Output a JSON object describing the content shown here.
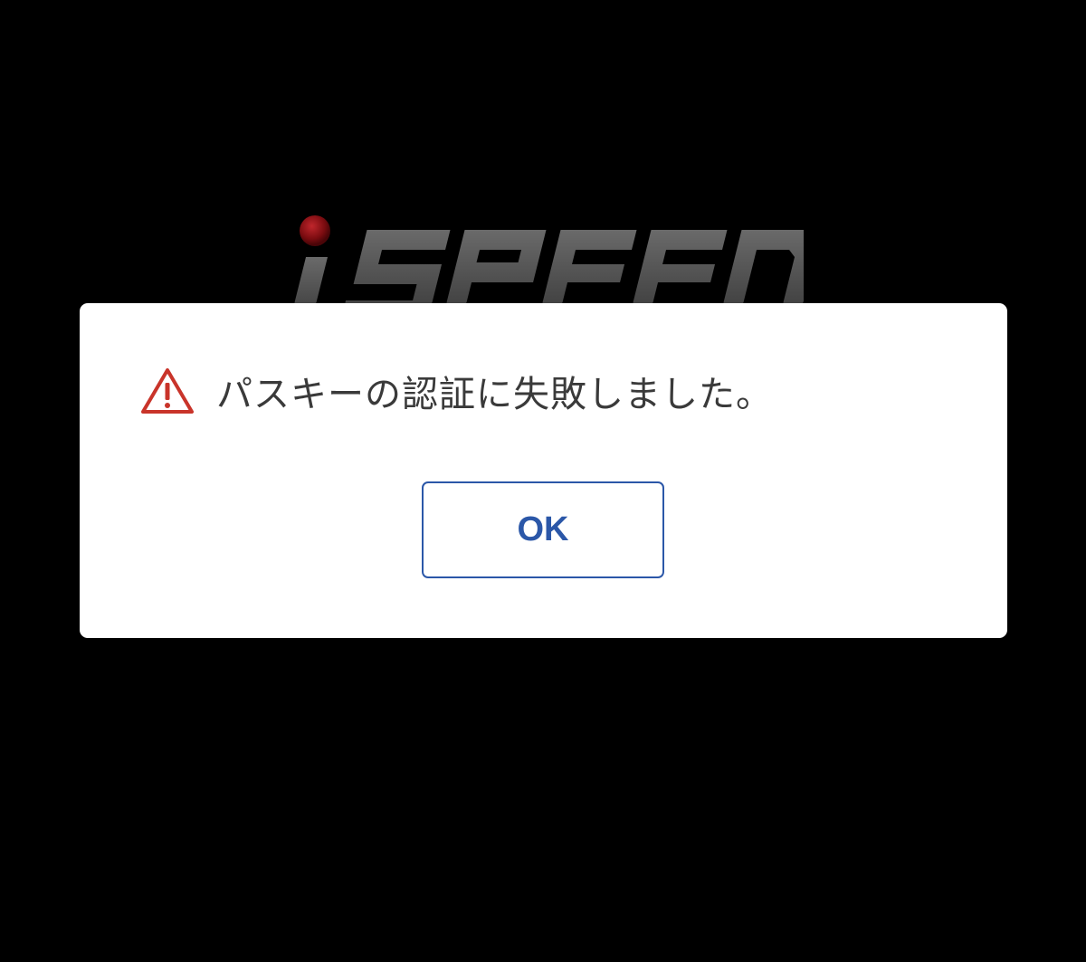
{
  "background": {
    "logo": {
      "text": "iSPEED",
      "name": "ispeed-logo",
      "dot_color": "#8b0f14",
      "letter_color": "#4a4a4a"
    }
  },
  "dialog": {
    "icon": "warning-triangle-icon",
    "icon_color": "#c9342a",
    "message": "パスキーの認証に失敗しました。",
    "ok_label": "OK",
    "accent_color": "#2b57a8"
  }
}
